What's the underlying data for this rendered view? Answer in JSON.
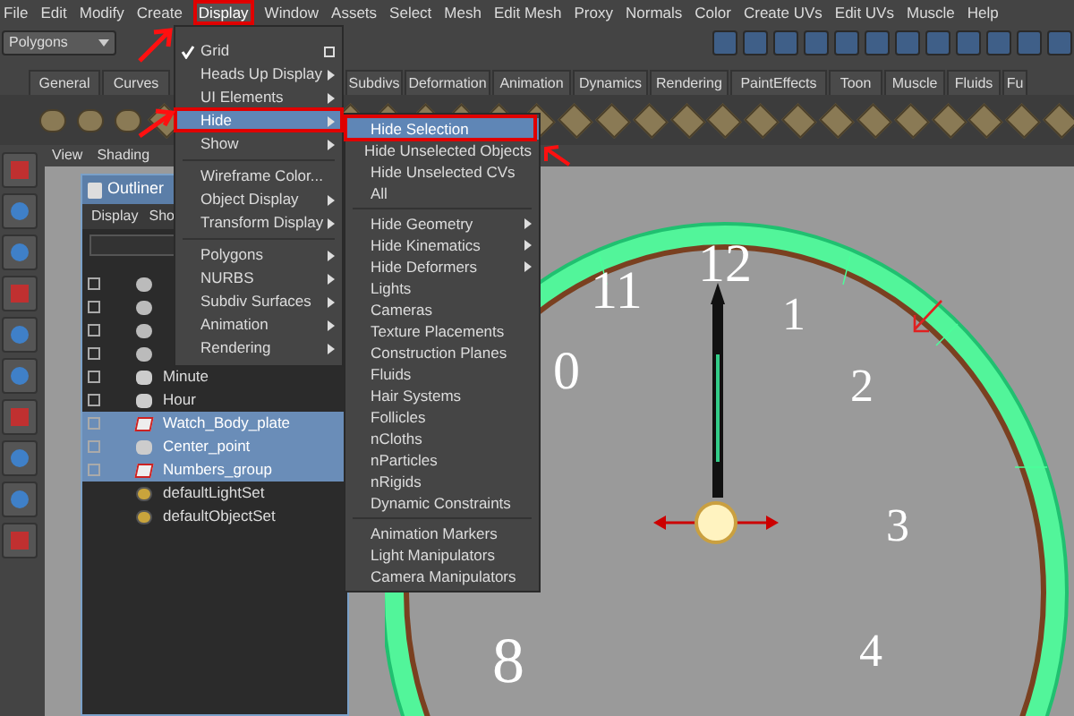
{
  "menu_bar": [
    {
      "label": "File",
      "selected": false
    },
    {
      "label": "Edit",
      "selected": false
    },
    {
      "label": "Modify",
      "selected": false
    },
    {
      "label": "Create",
      "selected": false
    },
    {
      "label": "Display",
      "selected": true
    },
    {
      "label": "Window",
      "selected": false
    },
    {
      "label": "Assets",
      "selected": false
    },
    {
      "label": "Select",
      "selected": false
    },
    {
      "label": "Mesh",
      "selected": false
    },
    {
      "label": "Edit Mesh",
      "selected": false
    },
    {
      "label": "Proxy",
      "selected": false
    },
    {
      "label": "Normals",
      "selected": false
    },
    {
      "label": "Color",
      "selected": false
    },
    {
      "label": "Create UVs",
      "selected": false
    },
    {
      "label": "Edit UVs",
      "selected": false
    },
    {
      "label": "Muscle",
      "selected": false
    },
    {
      "label": "Help",
      "selected": false
    }
  ],
  "mode_dropdown": {
    "value": "Polygons"
  },
  "shelf_tabs": [
    {
      "label": "General",
      "selected": false
    },
    {
      "label": "Curves",
      "selected": false
    },
    {
      "label": "Subdivs",
      "selected": false
    },
    {
      "label": "Deformation",
      "selected": false
    },
    {
      "label": "Animation",
      "selected": false
    },
    {
      "label": "Dynamics",
      "selected": false
    },
    {
      "label": "Rendering",
      "selected": false
    },
    {
      "label": "PaintEffects",
      "selected": false
    },
    {
      "label": "Toon",
      "selected": false
    },
    {
      "label": "Muscle",
      "selected": false
    },
    {
      "label": "Fluids",
      "selected": false
    },
    {
      "label": "Fu",
      "selected": false
    }
  ],
  "panel_menu": [
    "View",
    "Shading"
  ],
  "outliner": {
    "title": "Outliner",
    "menu": [
      "Display",
      "Sho"
    ],
    "items": [
      {
        "kind": "joint",
        "selected": false
      },
      {
        "kind": "joint",
        "selected": false
      },
      {
        "kind": "joint",
        "selected": false
      },
      {
        "kind": "joint",
        "selected": false
      },
      {
        "label": "Minute",
        "kind": "group",
        "selected": false
      },
      {
        "label": "Hour",
        "kind": "group",
        "selected": false
      },
      {
        "label": "Watch_Body_plate",
        "kind": "mesh",
        "selected": true
      },
      {
        "label": "Center_point",
        "kind": "group",
        "selected": true
      },
      {
        "label": "Numbers_group",
        "kind": "mesh",
        "selected": true
      },
      {
        "label": "defaultLightSet",
        "kind": "set",
        "selected": false
      },
      {
        "label": "defaultObjectSet",
        "kind": "set",
        "selected": false
      }
    ]
  },
  "display_menu": [
    {
      "kind": "item",
      "label": "Grid",
      "checked": true,
      "submenu": false,
      "option_box": true,
      "selected": false
    },
    {
      "kind": "item",
      "label": "Heads Up Display",
      "checked": false,
      "submenu": true,
      "option_box": false,
      "selected": false
    },
    {
      "kind": "item",
      "label": "UI Elements",
      "checked": false,
      "submenu": true,
      "option_box": false,
      "selected": false
    },
    {
      "kind": "item",
      "label": "Hide",
      "checked": false,
      "submenu": true,
      "option_box": false,
      "selected": true
    },
    {
      "kind": "item",
      "label": "Show",
      "checked": false,
      "submenu": true,
      "option_box": false,
      "selected": false
    },
    {
      "kind": "separator"
    },
    {
      "kind": "item",
      "label": "Wireframe Color...",
      "checked": false,
      "submenu": false,
      "option_box": false,
      "selected": false
    },
    {
      "kind": "item",
      "label": "Object Display",
      "checked": false,
      "submenu": true,
      "option_box": false,
      "selected": false
    },
    {
      "kind": "item",
      "label": "Transform Display",
      "checked": false,
      "submenu": true,
      "option_box": false,
      "selected": false
    },
    {
      "kind": "separator"
    },
    {
      "kind": "item",
      "label": "Polygons",
      "checked": false,
      "submenu": true,
      "option_box": false,
      "selected": false
    },
    {
      "kind": "item",
      "label": "NURBS",
      "checked": false,
      "submenu": true,
      "option_box": false,
      "selected": false
    },
    {
      "kind": "item",
      "label": "Subdiv Surfaces",
      "checked": false,
      "submenu": true,
      "option_box": false,
      "selected": false
    },
    {
      "kind": "item",
      "label": "Animation",
      "checked": false,
      "submenu": true,
      "option_box": false,
      "selected": false
    },
    {
      "kind": "item",
      "label": "Rendering",
      "checked": false,
      "submenu": true,
      "option_box": false,
      "selected": false
    }
  ],
  "hide_submenu": [
    {
      "kind": "item",
      "label": "Hide Selection",
      "submenu": false,
      "selected": true
    },
    {
      "kind": "item",
      "label": "Hide Unselected Objects",
      "submenu": false,
      "selected": false
    },
    {
      "kind": "item",
      "label": "Hide Unselected CVs",
      "submenu": false,
      "selected": false
    },
    {
      "kind": "item",
      "label": "All",
      "submenu": false,
      "selected": false
    },
    {
      "kind": "separator"
    },
    {
      "kind": "item",
      "label": "Hide Geometry",
      "submenu": true,
      "selected": false
    },
    {
      "kind": "item",
      "label": "Hide Kinematics",
      "submenu": true,
      "selected": false
    },
    {
      "kind": "item",
      "label": "Hide Deformers",
      "submenu": true,
      "selected": false
    },
    {
      "kind": "item",
      "label": "Lights",
      "submenu": false,
      "selected": false
    },
    {
      "kind": "item",
      "label": "Cameras",
      "submenu": false,
      "selected": false
    },
    {
      "kind": "item",
      "label": "Texture Placements",
      "submenu": false,
      "selected": false
    },
    {
      "kind": "item",
      "label": "Construction Planes",
      "submenu": false,
      "selected": false
    },
    {
      "kind": "item",
      "label": "Fluids",
      "submenu": false,
      "selected": false
    },
    {
      "kind": "item",
      "label": "Hair Systems",
      "submenu": false,
      "selected": false
    },
    {
      "kind": "item",
      "label": "Follicles",
      "submenu": false,
      "selected": false
    },
    {
      "kind": "item",
      "label": "nCloths",
      "submenu": false,
      "selected": false
    },
    {
      "kind": "item",
      "label": "nParticles",
      "submenu": false,
      "selected": false
    },
    {
      "kind": "item",
      "label": "nRigids",
      "submenu": false,
      "selected": false
    },
    {
      "kind": "item",
      "label": "Dynamic Constraints",
      "submenu": false,
      "selected": false
    },
    {
      "kind": "separator"
    },
    {
      "kind": "item",
      "label": "Animation Markers",
      "submenu": false,
      "selected": false
    },
    {
      "kind": "item",
      "label": "Light Manipulators",
      "submenu": false,
      "selected": false
    },
    {
      "kind": "item",
      "label": "Camera Manipulators",
      "submenu": false,
      "selected": false
    }
  ],
  "clock_numbers": [
    "12",
    "1",
    "2",
    "3",
    "4",
    "11",
    "0",
    "8"
  ]
}
